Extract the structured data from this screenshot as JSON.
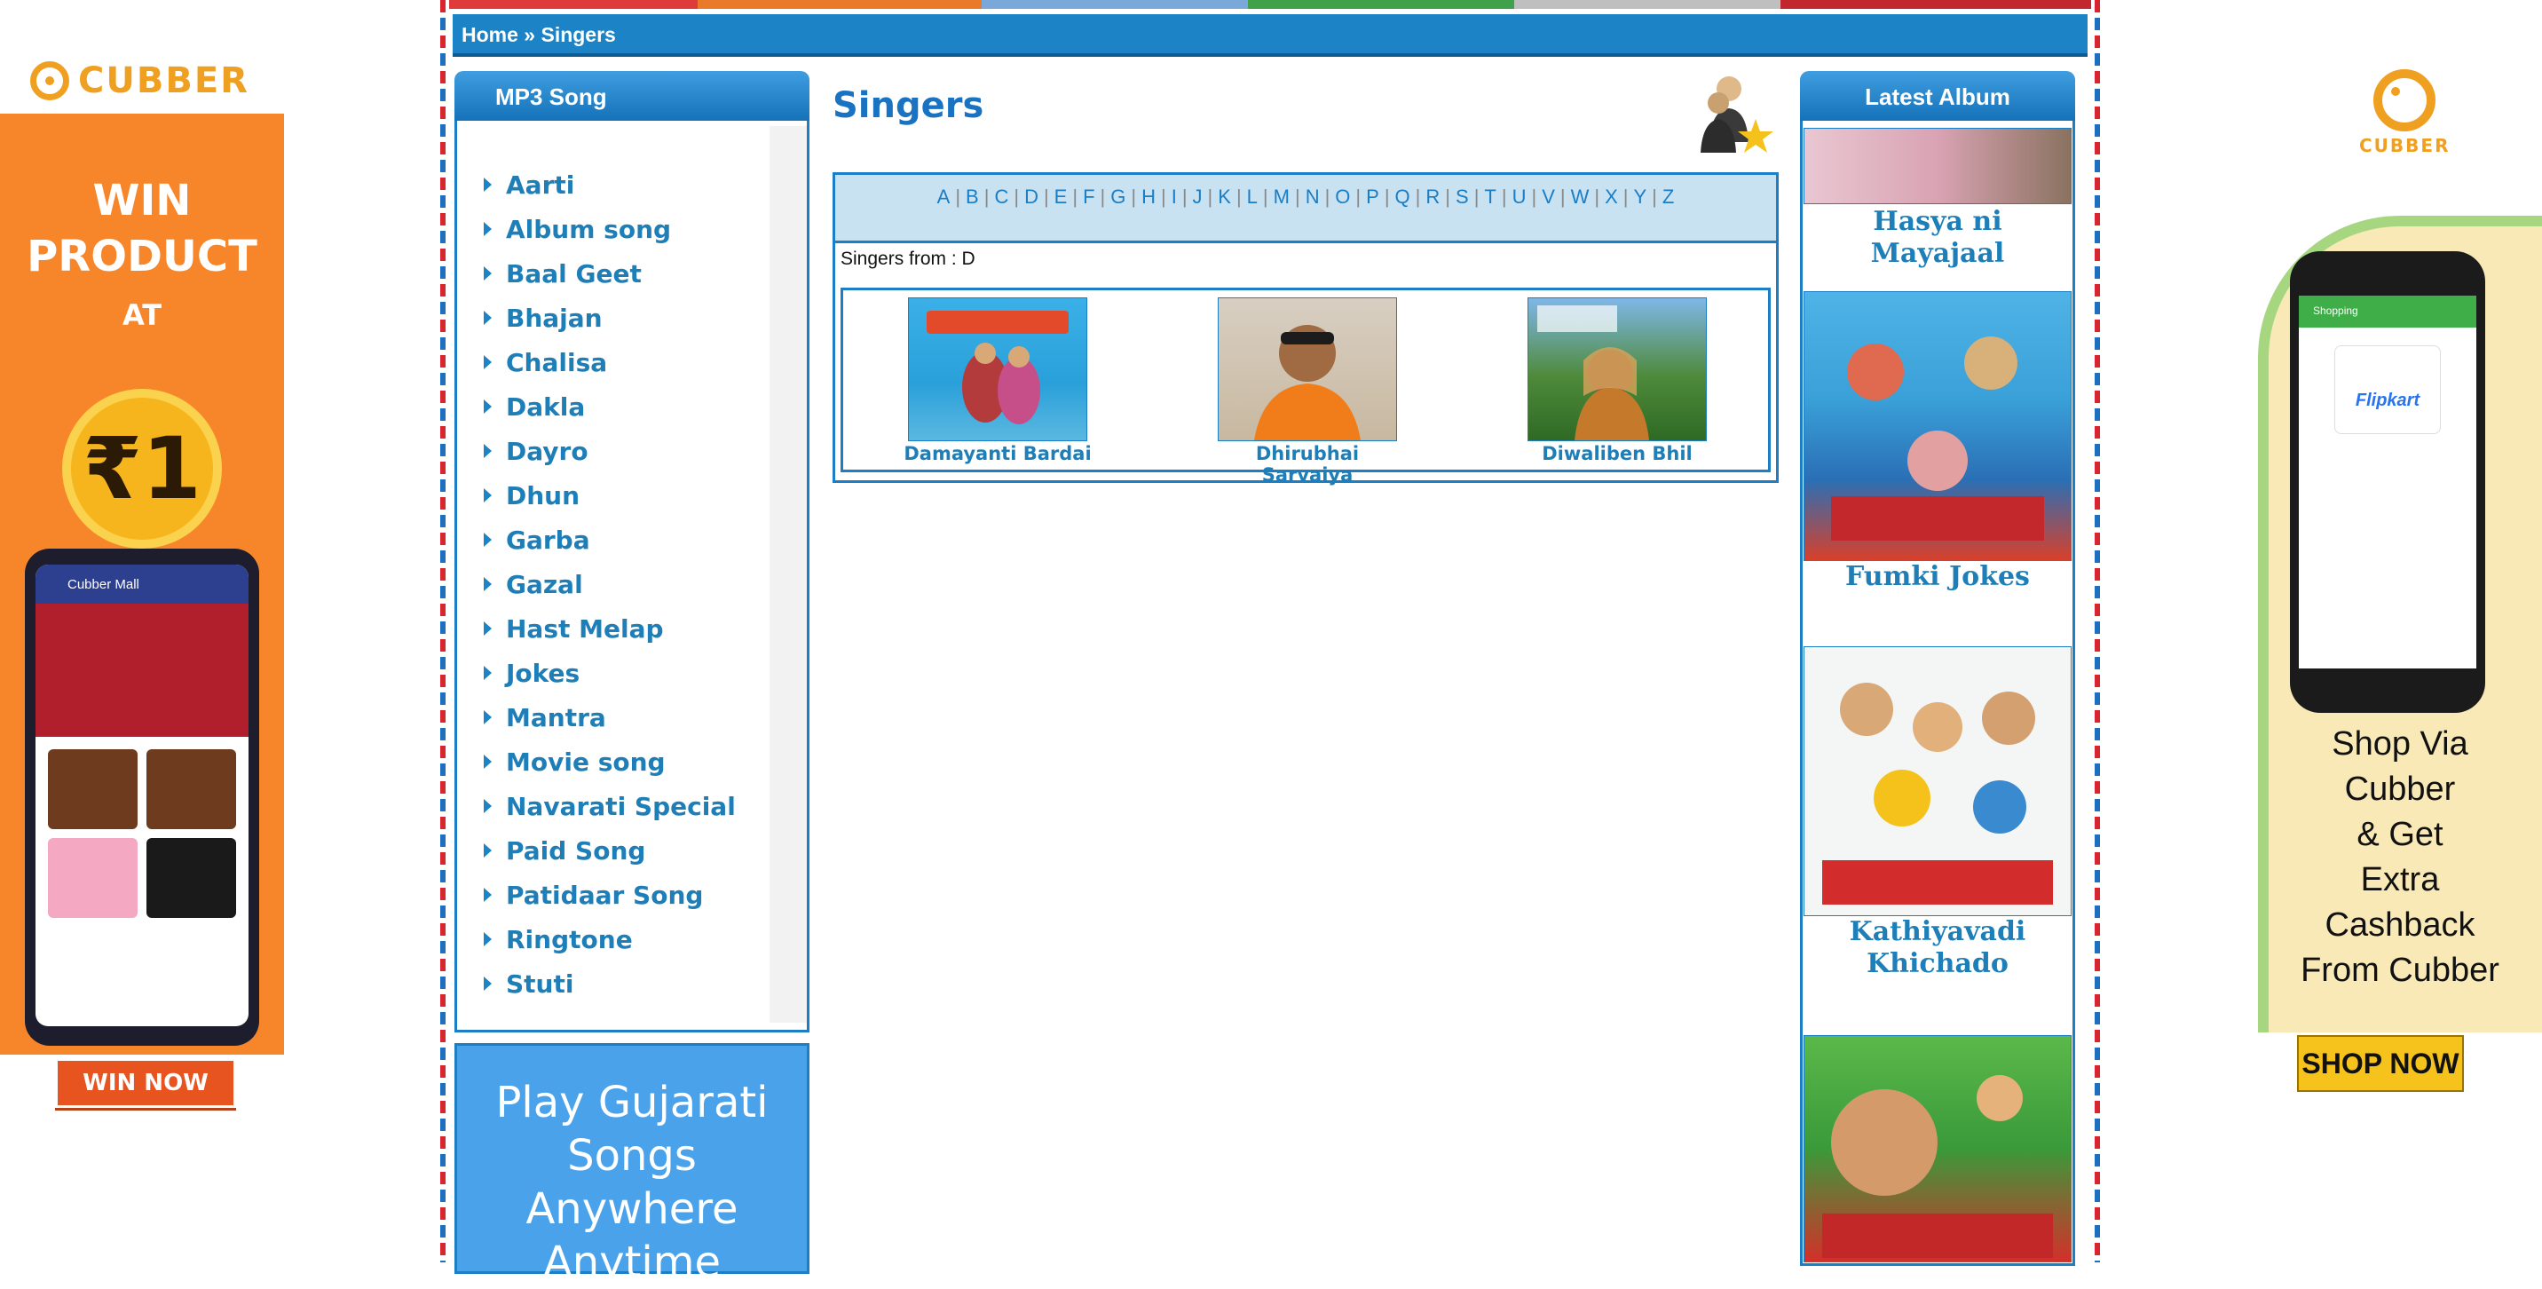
{
  "ad_left": {
    "logo_text": "CUBBER",
    "line1": "WIN",
    "line2": "PRODUCT",
    "line3": "AT",
    "price": "₹1",
    "phone_title": "Cubber Mall",
    "button": "WIN NOW"
  },
  "ad_right": {
    "logo_text": "CUBBER",
    "phone_bar": "Shopping",
    "phone_card": "Flipkart",
    "text_lines": [
      "Shop Via",
      "Cubber",
      "& Get",
      "Extra",
      "Cashback",
      "From Cubber"
    ],
    "button": "SHOP NOW"
  },
  "breadcrumb": "Home » Singers",
  "left_panel": {
    "title": "MP3 Song",
    "items": [
      "Aarti",
      "Album song",
      "Baal Geet",
      "Bhajan",
      "Chalisa",
      "Dakla",
      "Dayro",
      "Dhun",
      "Garba",
      "Gazal",
      "Hast Melap",
      "Jokes",
      "Mantra",
      "Movie song",
      "Navarati Special",
      "Paid Song",
      "Patidaar Song",
      "Ringtone",
      "Stuti"
    ]
  },
  "play_banner": [
    "Play Gujarati",
    "Songs",
    "Anywhere",
    "Anytime"
  ],
  "content": {
    "title": "Singers",
    "letters": [
      "A",
      "B",
      "C",
      "D",
      "E",
      "F",
      "G",
      "H",
      "I",
      "J",
      "K",
      "L",
      "M",
      "N",
      "O",
      "P",
      "Q",
      "R",
      "S",
      "T",
      "U",
      "V",
      "W",
      "X",
      "Y",
      "Z"
    ],
    "from_label": "Singers from : D",
    "singers": [
      "Damayanti Bardai",
      "Dhirubhai Sarvaiya",
      "Diwaliben Bhil"
    ]
  },
  "right_panel": {
    "title": "Latest Album",
    "albums": [
      "Hasya ni Mayajaal",
      "Fumki Jokes",
      "Kathiyavadi Khichado"
    ]
  },
  "colors": {
    "brand_blue": "#1c84c6",
    "link_blue": "#1e7fb8",
    "ad_orange": "#f7862a"
  }
}
